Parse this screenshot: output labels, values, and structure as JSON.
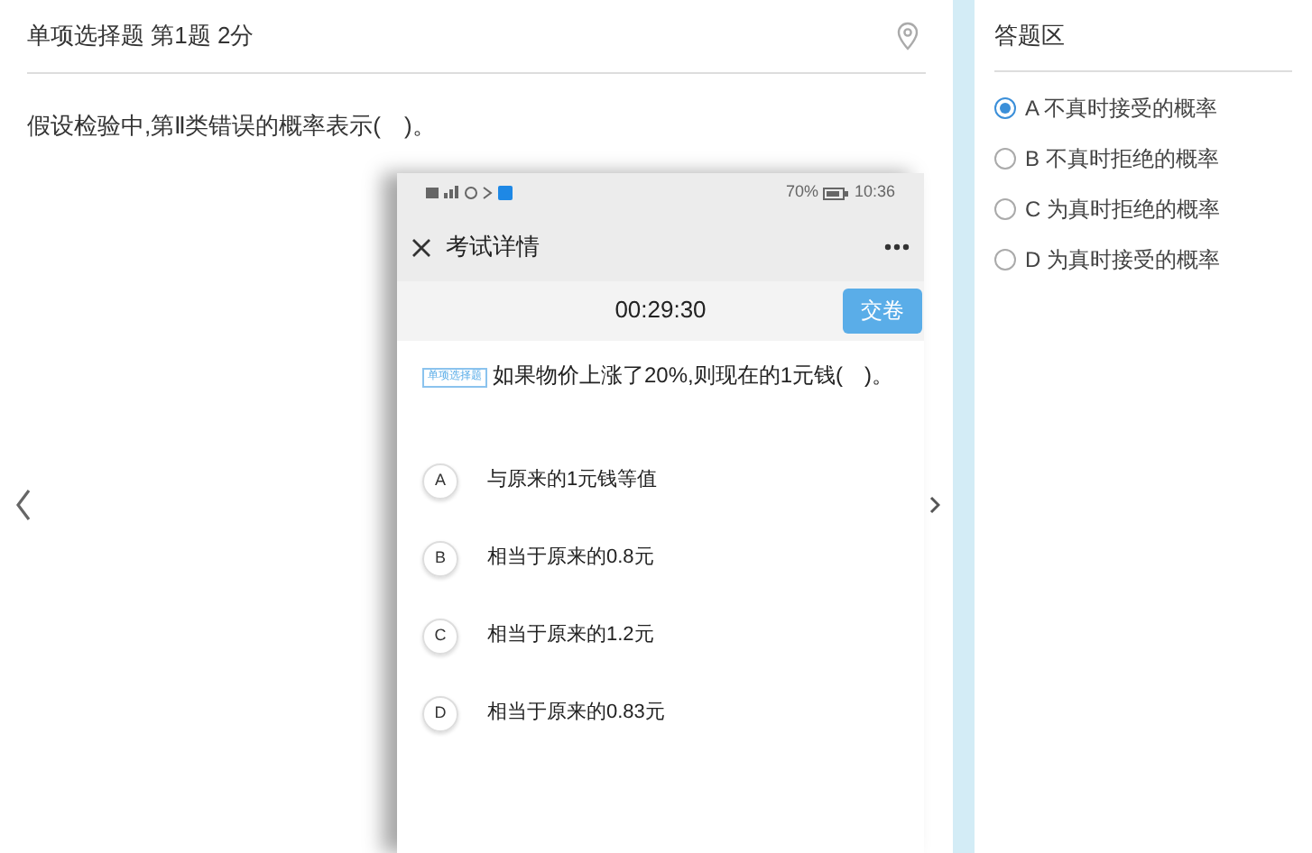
{
  "question": {
    "header": "单项选择题 第1题 2分",
    "text": "假设检验中,第Ⅱ类错误的概率表示(　)。"
  },
  "phone": {
    "status": {
      "battery": "70%",
      "time": "10:36"
    },
    "title": "考试详情",
    "timer": "00:29:30",
    "submit": "交卷",
    "tag": "单项选择题",
    "question": "如果物价上涨了20%,则现在的1元钱(　)。",
    "options": [
      {
        "letter": "A",
        "text": "与原来的1元钱等值"
      },
      {
        "letter": "B",
        "text": "相当于原来的0.8元"
      },
      {
        "letter": "C",
        "text": "相当于原来的1.2元"
      },
      {
        "letter": "D",
        "text": "相当于原来的0.83元"
      }
    ]
  },
  "answer_area": {
    "title": "答题区",
    "options": [
      {
        "letter": "A",
        "text": "不真时接受的概率",
        "selected": true
      },
      {
        "letter": "B",
        "text": "不真时拒绝的概率",
        "selected": false
      },
      {
        "letter": "C",
        "text": "为真时拒绝的概率",
        "selected": false
      },
      {
        "letter": "D",
        "text": "为真时接受的概率",
        "selected": false
      }
    ]
  }
}
